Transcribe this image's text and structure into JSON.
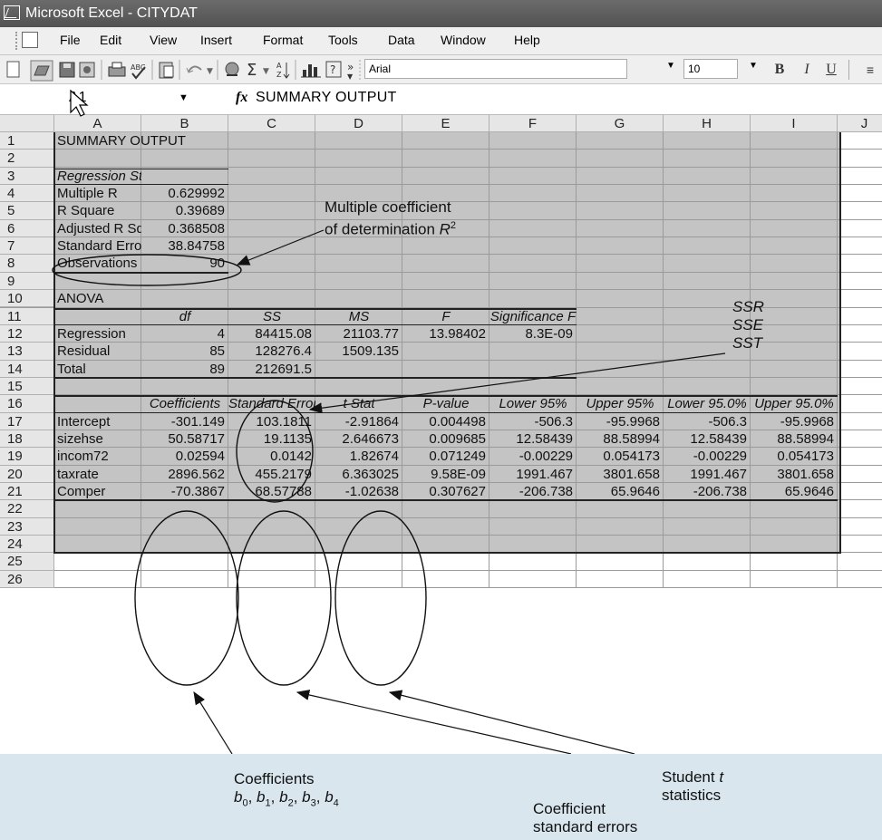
{
  "window": {
    "title": "Microsoft Excel - CITYDAT"
  },
  "menu": [
    "File",
    "Edit",
    "View",
    "Insert",
    "Format",
    "Tools",
    "Data",
    "Window",
    "Help"
  ],
  "toolbar": {
    "font": "Arial",
    "size": "10",
    "bold": "B",
    "italic": "I",
    "underline": "U",
    "sigma": "Σ",
    "more": "»"
  },
  "formula_bar": {
    "name_box": "A1",
    "fx": "fx",
    "content": "SUMMARY OUTPUT"
  },
  "columns": [
    "A",
    "B",
    "C",
    "D",
    "E",
    "F",
    "G",
    "H",
    "I",
    "J"
  ],
  "rows": [
    [
      "SUMMARY OUTPUT",
      "",
      "",
      "",
      "",
      "",
      "",
      "",
      ""
    ],
    [
      "",
      "",
      "",
      "",
      "",
      "",
      "",
      "",
      ""
    ],
    [
      "Regression Statistics",
      "",
      "",
      "",
      "",
      "",
      "",
      "",
      ""
    ],
    [
      "Multiple R",
      "0.629992",
      "",
      "",
      "",
      "",
      "",
      "",
      ""
    ],
    [
      "R Square",
      "0.39689",
      "",
      "",
      "",
      "",
      "",
      "",
      ""
    ],
    [
      "Adjusted R Square",
      "0.368508",
      "",
      "",
      "",
      "",
      "",
      "",
      ""
    ],
    [
      "Standard Error",
      "38.84758",
      "",
      "",
      "",
      "",
      "",
      "",
      ""
    ],
    [
      "Observations",
      "90",
      "",
      "",
      "",
      "",
      "",
      "",
      ""
    ],
    [
      "",
      "",
      "",
      "",
      "",
      "",
      "",
      "",
      ""
    ],
    [
      "ANOVA",
      "",
      "",
      "",
      "",
      "",
      "",
      "",
      ""
    ],
    [
      "",
      "df",
      "SS",
      "MS",
      "F",
      "Significance F",
      "",
      "",
      ""
    ],
    [
      "Regression",
      "4",
      "84415.08",
      "21103.77",
      "13.98402",
      "8.3E-09",
      "",
      "",
      ""
    ],
    [
      "Residual",
      "85",
      "128276.4",
      "1509.135",
      "",
      "",
      "",
      "",
      ""
    ],
    [
      "Total",
      "89",
      "212691.5",
      "",
      "",
      "",
      "",
      "",
      ""
    ],
    [
      "",
      "",
      "",
      "",
      "",
      "",
      "",
      "",
      ""
    ],
    [
      "",
      "Coefficients",
      "Standard Error",
      "t Stat",
      "P-value",
      "Lower 95%",
      "Upper 95%",
      "Lower 95.0%",
      "Upper 95.0%"
    ],
    [
      "Intercept",
      "-301.149",
      "103.1811",
      "-2.91864",
      "0.004498",
      "-506.3",
      "-95.9968",
      "-506.3",
      "-95.9968"
    ],
    [
      "sizehse",
      "50.58717",
      "19.1135",
      "2.646673",
      "0.009685",
      "12.58439",
      "88.58994",
      "12.58439",
      "88.58994"
    ],
    [
      "incom72",
      "0.02594",
      "0.0142",
      "1.82674",
      "0.071249",
      "-0.00229",
      "0.054173",
      "-0.00229",
      "0.054173"
    ],
    [
      "taxrate",
      "2896.562",
      "455.2179",
      "6.363025",
      "9.58E-09",
      "1991.467",
      "3801.658",
      "1991.467",
      "3801.658"
    ],
    [
      "Comper",
      "-70.3867",
      "68.57788",
      "-1.02638",
      "0.307627",
      "-206.738",
      "65.9646",
      "-206.738",
      "65.9646"
    ],
    [
      "",
      "",
      "",
      "",
      "",
      "",
      "",
      "",
      ""
    ],
    [
      "",
      "",
      "",
      "",
      "",
      "",
      "",
      "",
      ""
    ],
    [
      "",
      "",
      "",
      "",
      "",
      "",
      "",
      "",
      ""
    ],
    [
      "",
      "",
      "",
      "",
      "",
      "",
      "",
      "",
      ""
    ],
    [
      "",
      "",
      "",
      "",
      "",
      "",
      "",
      "",
      ""
    ]
  ],
  "annotations": {
    "r2_line1": "Multiple coefficient",
    "r2_line2": "of determination ",
    "r2_sym": "R",
    "r2_sup": "2",
    "ssr": "SSR",
    "sse": "SSE",
    "sst": "SST",
    "coef_line1": "Coefficients",
    "coef_b0": "b",
    "coef_sub0": "0",
    "coef_b1": "b",
    "coef_sub1": "1",
    "coef_b2": "b",
    "coef_sub2": "2",
    "coef_b3": "b",
    "coef_sub3": "3",
    "coef_b4": "b",
    "coef_sub4": "4",
    "se_line1": "Coefficient",
    "se_line2": "standard errors",
    "t_line1a": "Student ",
    "t_line1b": "t",
    "t_line2": "statistics"
  }
}
